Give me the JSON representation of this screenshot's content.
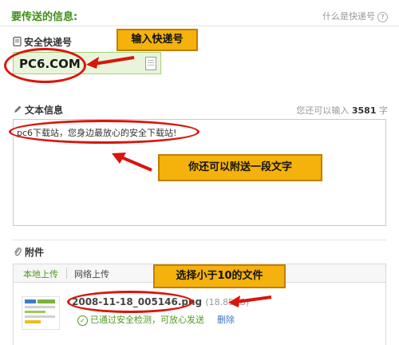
{
  "header": {
    "title": "要传送的信息:",
    "help_link": "什么是快递号",
    "help_icon": "?"
  },
  "code_section": {
    "label": "安全快递号",
    "value": "PC6.COM"
  },
  "message_section": {
    "label": "文本信息",
    "counter_prefix": "您还可以输入",
    "counter_value": "3581",
    "counter_suffix": "字",
    "text": "pc6下载站，您身边最放心的安全下载站!"
  },
  "attachment_section": {
    "label": "附件",
    "tabs": [
      "本地上传",
      "网络上传"
    ],
    "file_name": "2008-11-18_005146.png",
    "file_size": "(18.85KB)",
    "status_text": "已通过安全检测，可放心发送",
    "delete_label": "删除"
  },
  "annotations": {
    "callout_code": "输入快递号",
    "callout_message": "你还可以附送一段文字",
    "callout_file": "选择小于10的文件"
  },
  "colors": {
    "accent_green": "#4f9a1e",
    "callout_fill": "#f5b20c",
    "annotation_red": "#d8160c"
  }
}
